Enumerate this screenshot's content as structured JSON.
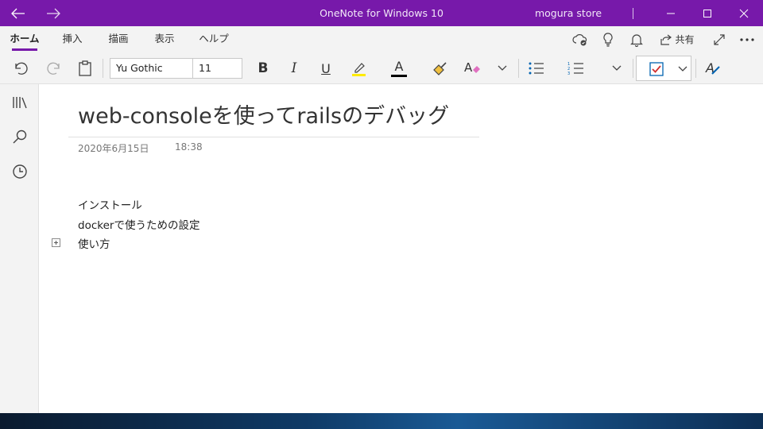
{
  "window": {
    "title": "OneNote for Windows 10",
    "user": "mogura store",
    "accent": "#7719aa"
  },
  "nav": {
    "back_icon": "arrow-left-icon",
    "forward_icon": "arrow-right-icon"
  },
  "ribbon": {
    "tabs": [
      {
        "label": "ホーム",
        "active": true
      },
      {
        "label": "挿入",
        "active": false
      },
      {
        "label": "描画",
        "active": false
      },
      {
        "label": "表示",
        "active": false
      },
      {
        "label": "ヘルプ",
        "active": false
      }
    ],
    "share_label": "共有"
  },
  "toolbar": {
    "font_name": "Yu Gothic",
    "font_size": "11",
    "bold_label": "B",
    "italic_label": "I",
    "underline_label": "U",
    "font_color_label": "A",
    "highlight_color": "#ffeb00",
    "font_color": "#000000",
    "todo_check_color": "#d03030"
  },
  "page": {
    "title": "web-consoleを使ってrailsのデバッグ",
    "date": "2020年6月15日",
    "time": "18:38",
    "lines": [
      "インストール",
      "dockerで使うための設定",
      "使い方"
    ]
  }
}
